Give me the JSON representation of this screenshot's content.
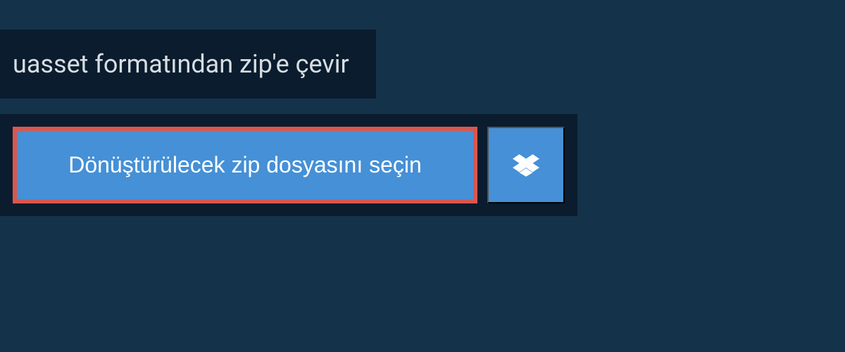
{
  "header": {
    "title": "uasset formatından zip'e çevir"
  },
  "upload": {
    "select_button_label": "Dönüştürülecek zip dosyasını seçin",
    "dropbox_icon": "dropbox-icon"
  },
  "colors": {
    "background": "#15324b",
    "panel": "#0a1c2e",
    "button": "#4590d6",
    "highlight_border": "#d9574d",
    "text_light": "#d8dde2",
    "text_white": "#ffffff"
  }
}
